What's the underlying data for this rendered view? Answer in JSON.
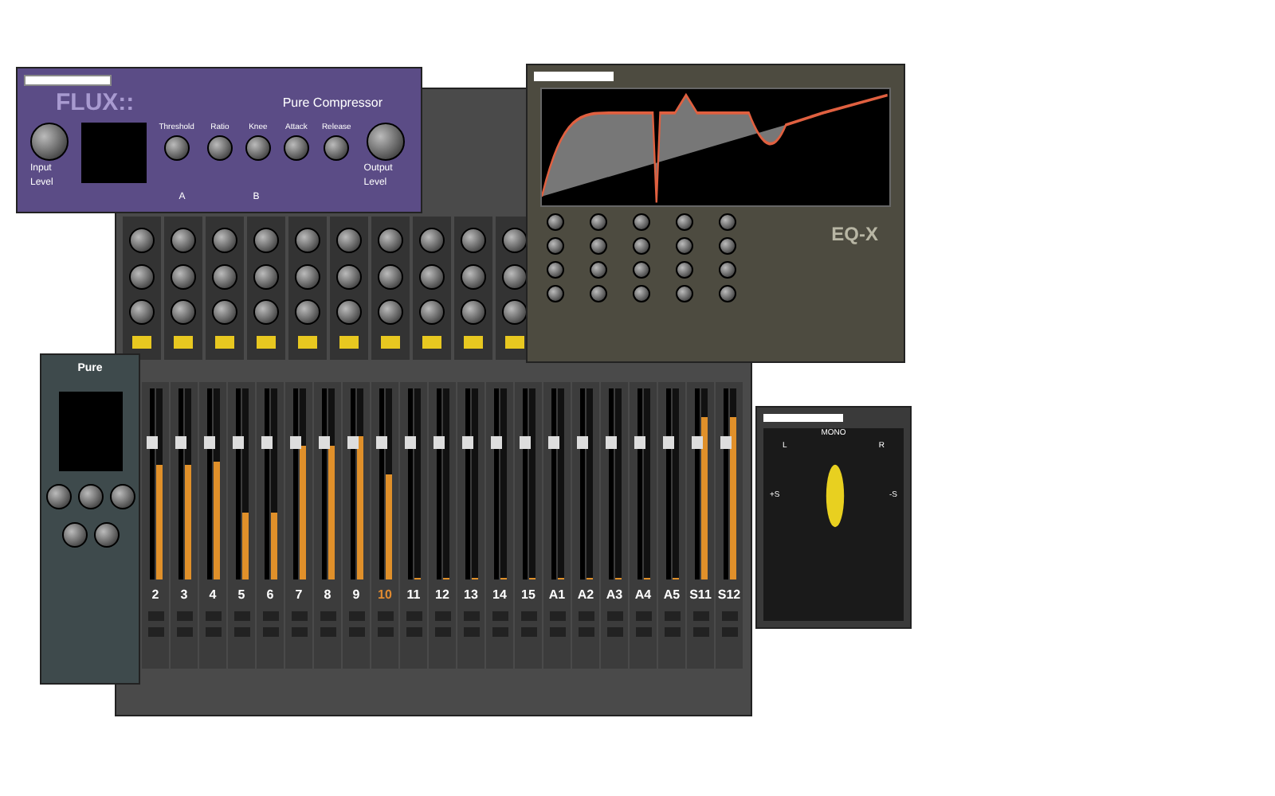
{
  "compressor": {
    "brand": "FLUX::",
    "title": "Pure Compressor",
    "input_label": "Input Level",
    "output_label": "Output Level",
    "knobs": [
      "Threshold",
      "Ratio",
      "Knee"
    ],
    "side_knobs": [
      "Attack",
      "Release"
    ],
    "slots": [
      "A",
      "B"
    ]
  },
  "eq": {
    "brand": "EQ-X"
  },
  "side_panel": {
    "title": "Pure"
  },
  "mixer": {
    "channels": [
      {
        "label": "2",
        "level": 0.6,
        "selected": false
      },
      {
        "label": "3",
        "level": 0.6,
        "selected": false
      },
      {
        "label": "4",
        "level": 0.62,
        "selected": false
      },
      {
        "label": "5",
        "level": 0.35,
        "selected": false
      },
      {
        "label": "6",
        "level": 0.35,
        "selected": false
      },
      {
        "label": "7",
        "level": 0.7,
        "selected": false
      },
      {
        "label": "8",
        "level": 0.7,
        "selected": false
      },
      {
        "label": "9",
        "level": 0.75,
        "selected": false
      },
      {
        "label": "10",
        "level": 0.55,
        "selected": true
      },
      {
        "label": "11",
        "level": 0,
        "selected": false
      },
      {
        "label": "12",
        "level": 0,
        "selected": false
      },
      {
        "label": "13",
        "level": 0,
        "selected": false
      },
      {
        "label": "14",
        "level": 0,
        "selected": false
      },
      {
        "label": "15",
        "level": 0,
        "selected": false
      },
      {
        "label": "A1",
        "level": 0,
        "selected": false
      },
      {
        "label": "A2",
        "level": 0,
        "selected": false
      },
      {
        "label": "A3",
        "level": 0,
        "selected": false
      },
      {
        "label": "A4",
        "level": 0,
        "selected": false
      },
      {
        "label": "A5",
        "level": 0,
        "selected": false
      },
      {
        "label": "S11",
        "level": 0.85,
        "selected": false
      },
      {
        "label": "S12",
        "level": 0.85,
        "selected": false
      }
    ]
  },
  "scope": {
    "top": "MONO",
    "left": "L",
    "right": "R",
    "plus": "+S",
    "minus": "-S"
  }
}
